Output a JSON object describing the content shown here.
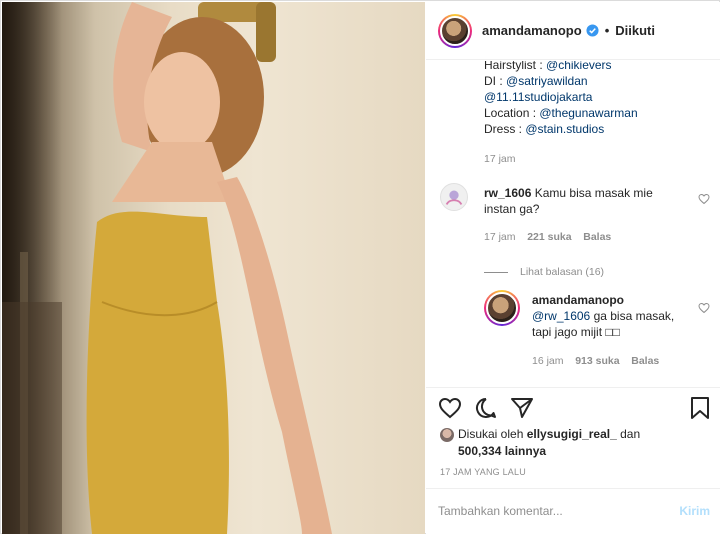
{
  "header": {
    "username": "amandamanopo",
    "follow_label": "Diikuti",
    "separator": "•"
  },
  "caption": {
    "lines": [
      {
        "label": "Hairstylist : ",
        "link": "@chikievers"
      },
      {
        "label": "DI : ",
        "link": "@satriyawildan"
      },
      {
        "label": "",
        "link": "@11.11studiojakarta"
      },
      {
        "label": "Location : ",
        "link": "@thegunawarman"
      },
      {
        "label": "Dress : ",
        "link": "@stain.studios"
      }
    ],
    "time": "17 jam"
  },
  "comments": [
    {
      "username": "rw_1606",
      "text": "Kamu bisa masak mie instan ga?",
      "time": "17 jam",
      "likes": "221 suka",
      "reply": "Balas"
    }
  ],
  "view_replies": "Lihat balasan (16)",
  "reply": {
    "username": "amandamanopo",
    "mention": "@rw_1606",
    "text": "ga bisa masak, tapi jago mijit □□",
    "time": "16 jam",
    "likes": "913 suka",
    "reply": "Balas"
  },
  "likes": {
    "prefix": "Disukai oleh",
    "user": "ellysugigi_real_",
    "connector": "dan",
    "count": "500,334 lainnya"
  },
  "time_ago": "17 JAM YANG LALU",
  "add_comment": {
    "placeholder": "Tambahkan komentar...",
    "post_label": "Kirim"
  },
  "colors": {
    "link": "#00376b",
    "verified": "#3897f0",
    "post_disabled": "#b2dffc",
    "dress": "#d4a93a"
  }
}
